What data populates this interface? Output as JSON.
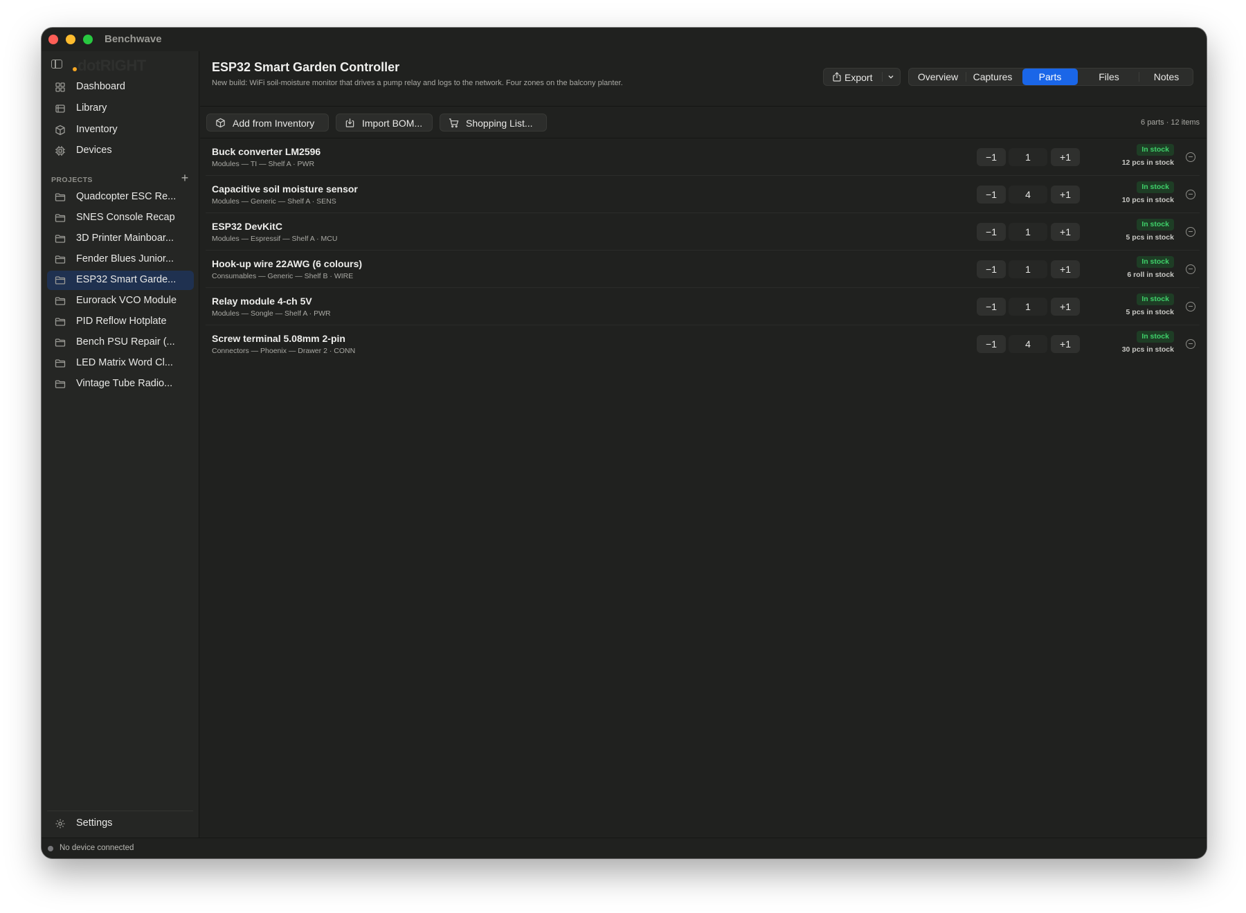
{
  "window": {
    "app_title": "Benchwave"
  },
  "sidebar": {
    "brand": "dotRIGHT",
    "nav": [
      {
        "label": "Dashboard",
        "icon": "grid-icon"
      },
      {
        "label": "Library",
        "icon": "book-icon"
      },
      {
        "label": "Inventory",
        "icon": "box-icon"
      },
      {
        "label": "Devices",
        "icon": "chip-icon"
      }
    ],
    "projects_label": "PROJECTS",
    "add_label": "+",
    "projects": [
      {
        "label": "Quadcopter ESC Re..."
      },
      {
        "label": "SNES Console Recap"
      },
      {
        "label": "3D Printer Mainboar..."
      },
      {
        "label": "Fender Blues Junior..."
      },
      {
        "label": "ESP32 Smart Garde...",
        "active": true
      },
      {
        "label": "Eurorack VCO Module"
      },
      {
        "label": "PID Reflow Hotplate"
      },
      {
        "label": "Bench PSU Repair (..."
      },
      {
        "label": "LED Matrix Word Cl..."
      },
      {
        "label": "Vintage Tube Radio..."
      }
    ],
    "settings_label": "Settings"
  },
  "status": {
    "text": "No device connected"
  },
  "header": {
    "title": "ESP32 Smart Garden Controller",
    "subtitle": "New build: WiFi soil-moisture monitor that drives a pump relay and logs to the network. Four zones on the balcony planter.",
    "export_label": "Export",
    "tabs": [
      "Overview",
      "Captures",
      "Parts",
      "Files",
      "Notes"
    ],
    "active_tab": "Parts"
  },
  "toolbar": {
    "add_from_inventory": "Add from Inventory",
    "import_bom": "Import BOM...",
    "shopping_list": "Shopping List...",
    "counts": "6 parts · 12 items"
  },
  "parts": [
    {
      "name": "Buck converter LM2596",
      "meta": "Modules — TI — Shelf A · PWR",
      "qty": "1",
      "badge": "In stock",
      "stock": "12 pcs in stock"
    },
    {
      "name": "Capacitive soil moisture sensor",
      "meta": "Modules — Generic — Shelf A · SENS",
      "qty": "4",
      "badge": "In stock",
      "stock": "10 pcs in stock"
    },
    {
      "name": "ESP32 DevKitC",
      "meta": "Modules — Espressif — Shelf A · MCU",
      "qty": "1",
      "badge": "In stock",
      "stock": "5 pcs in stock"
    },
    {
      "name": "Hook-up wire 22AWG (6 colours)",
      "meta": "Consumables — Generic — Shelf B · WIRE",
      "qty": "1",
      "badge": "In stock",
      "stock": "6 roll in stock"
    },
    {
      "name": "Relay module 4-ch 5V",
      "meta": "Modules — Songle — Shelf A · PWR",
      "qty": "1",
      "badge": "In stock",
      "stock": "5 pcs in stock"
    },
    {
      "name": "Screw terminal 5.08mm 2-pin",
      "meta": "Connectors — Phoenix — Drawer 2 · CONN",
      "qty": "4",
      "badge": "In stock",
      "stock": "30 pcs in stock"
    }
  ],
  "stepper": {
    "minus": "−1",
    "plus": "+1"
  },
  "colors": {
    "accent": "#1a66e8",
    "in_stock_bg": "#1e3d25",
    "in_stock_fg": "#3fd16a",
    "window_bg": "#20211f"
  }
}
